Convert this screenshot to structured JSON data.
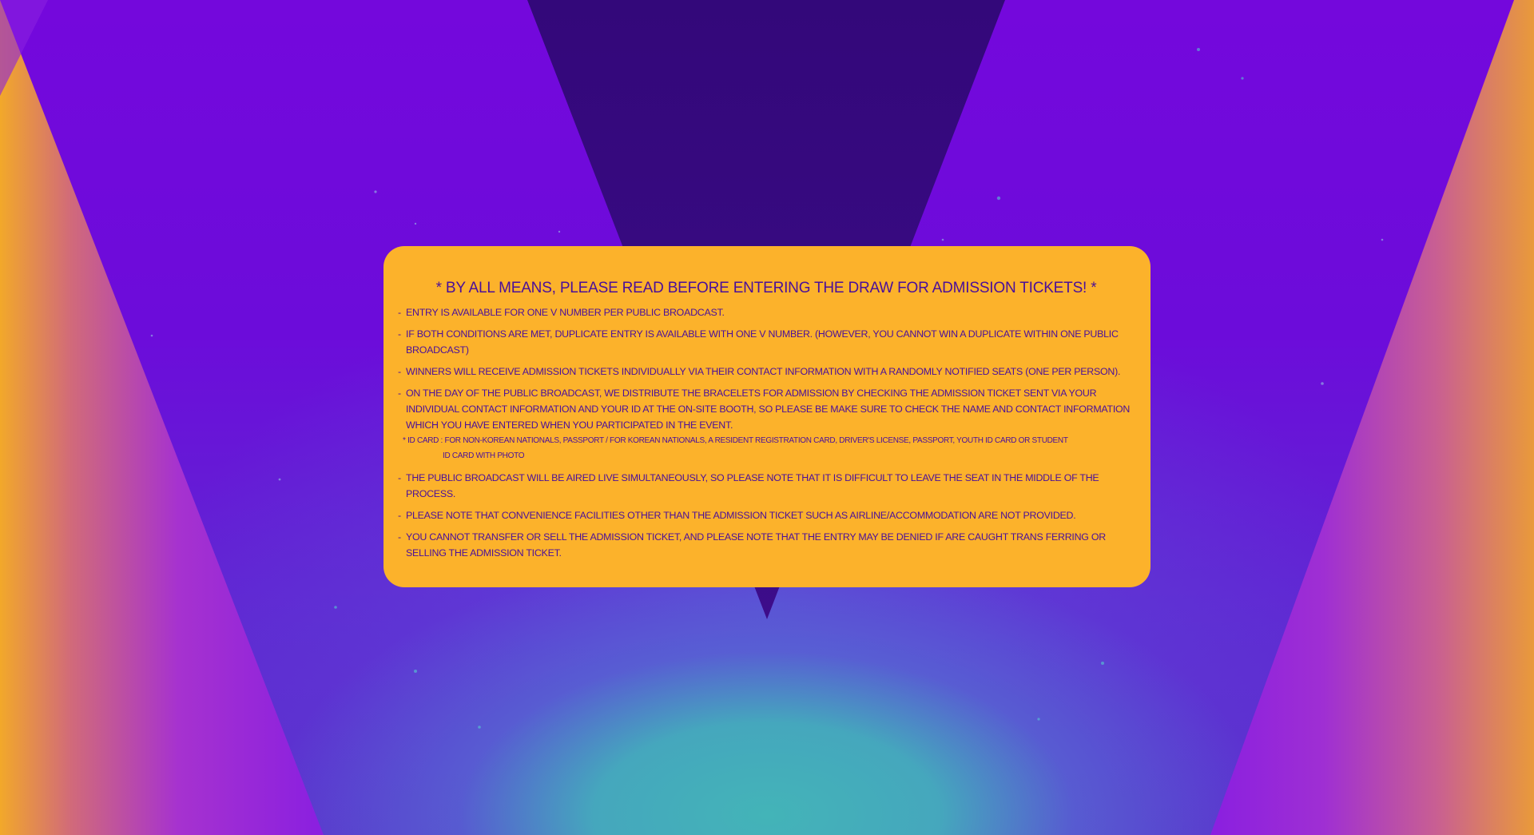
{
  "notice": {
    "title": "* BY ALL MEANS, PLEASE READ BEFORE ENTERING THE DRAW FOR ADMISSION TICKETS! *",
    "rules": [
      "ENTRY IS AVAILABLE FOR ONE V NUMBER PER PUBLIC BROADCAST.",
      "IF BOTH CONDITIONS ARE MET, DUPLICATE ENTRY IS AVAILABLE WITH ONE V NUMBER. (HOWEVER, YOU CANNOT WIN A DUPLICATE WITHIN ONE PUBLIC BROADCAST)",
      "WINNERS WILL RECEIVE ADMISSION TICKETS INDIVIDUALLY VIA THEIR CONTACT INFORMATION WITH A RANDOMLY NOTIFIED SEATS  (ONE PER PERSON).",
      "ON THE DAY OF THE PUBLIC BROADCAST, WE DISTRIBUTE THE BRACELETS FOR ADMISSION BY CHECKING THE ADMISSION TICKET SENT VIA YOUR INDIVIDUAL CONTACT INFORMATION AND YOUR ID AT THE ON-SITE BOOTH, SO PLEASE BE MAKE SURE TO CHECK THE NAME AND CONTACT INFORMATION WHICH YOU HAVE ENTERED WHEN YOU PARTICIPATED IN THE EVENT.",
      "THE PUBLIC BROADCAST WILL BE AIRED LIVE SIMULTANEOUSLY, SO PLEASE NOTE THAT IT IS DIFFICULT TO LEAVE THE SEAT IN THE MIDDLE OF THE PROCESS.",
      "PLEASE NOTE THAT CONVENIENCE FACILITIES OTHER THAN THE ADMISSION TICKET SUCH AS AIRLINE/ACCOMMODATION ARE NOT PROVIDED.",
      "YOU CANNOT TRANSFER OR SELL THE ADMISSION TICKET, AND PLEASE NOTE THAT THE ENTRY MAY BE DENIED IF ARE CAUGHT TRANS FERRING OR SELLING THE ADMISSION TICKET."
    ],
    "dash": "-",
    "id_note": {
      "line1": "* ID CARD : FOR NON-KOREAN NATIONALS, PASSPORT / FOR KOREAN NATIONALS, A RESIDENT REGISTRATION CARD, DRIVER'S LICENSE, PASSPORT, YOUTH ID CARD OR STUDENT",
      "line2": "ID CARD WITH PHOTO"
    }
  },
  "colors": {
    "background_purple": "#7408dc",
    "dark_triangle": "#3a0a7e",
    "side_orange": "#f0a52a",
    "glow_teal": "#43b4b8",
    "card_yellow": "#fcb22b",
    "text_purple": "#4a0f9a"
  }
}
